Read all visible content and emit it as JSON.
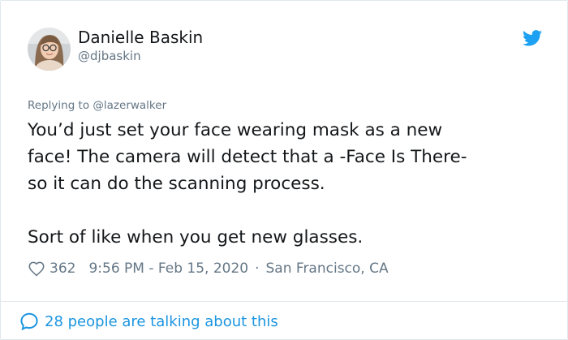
{
  "author": {
    "display_name": "Danielle Baskin",
    "handle": "@djbaskin"
  },
  "reply": {
    "prefix": "Replying to ",
    "to": "@lazerwalker"
  },
  "tweet": {
    "lines": [
      "You’d just set your face wearing mask as a new",
      "face! The camera will detect that a -Face Is There-",
      "so it can do the scanning process.",
      "Sort of like when you get new glasses."
    ]
  },
  "meta": {
    "likes": "362",
    "time": "9:56 PM - Feb 15, 2020",
    "separator": "·",
    "location": "San Francisco, CA"
  },
  "footer": {
    "talking": "28 people are talking about this"
  },
  "colors": {
    "brand": "#1da1f2",
    "link": "#1b95e0",
    "muted": "#657786",
    "text": "#14171a"
  },
  "icons": {
    "logo": "twitter-bird-icon",
    "like": "heart-icon",
    "conversation": "speech-bubble-icon"
  }
}
